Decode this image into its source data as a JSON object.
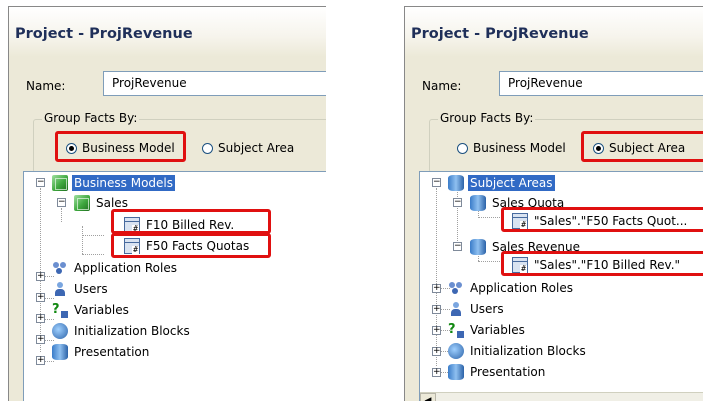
{
  "left": {
    "title": "Project - ProjRevenue",
    "name_label": "Name:",
    "name_value": "ProjRevenue",
    "group_label": "Group Facts By:",
    "radio_business": "Business Model",
    "radio_subject": "Subject Area",
    "selected_radio": "Business Model",
    "tree": {
      "root": "Business Models",
      "child": "Sales",
      "leaf1": "F10 Billed Rev.",
      "leaf2": "F50 Facts Quotas",
      "roles": "Application Roles",
      "users": "Users",
      "variables": "Variables",
      "init_blocks": "Initialization Blocks",
      "presentation": "Presentation"
    }
  },
  "right": {
    "title": "Project - ProjRevenue",
    "name_label": "Name:",
    "name_value": "ProjRevenue",
    "group_label": "Group Facts By:",
    "radio_business": "Business Model",
    "radio_subject": "Subject Area",
    "selected_radio": "Subject Area",
    "tree": {
      "root": "Subject Areas",
      "child1": "Sales Quota",
      "leaf1": "\"Sales\".\"F50 Facts Quot...",
      "child2": "Sales Revenue",
      "leaf2": "\"Sales\".\"F10 Billed Rev.\"",
      "roles": "Application Roles",
      "users": "Users",
      "variables": "Variables",
      "init_blocks": "Initialization Blocks",
      "presentation": "Presentation"
    }
  },
  "colors": {
    "highlight": "#e01010",
    "selection": "#316ac5",
    "title_text": "#1f2f59"
  }
}
